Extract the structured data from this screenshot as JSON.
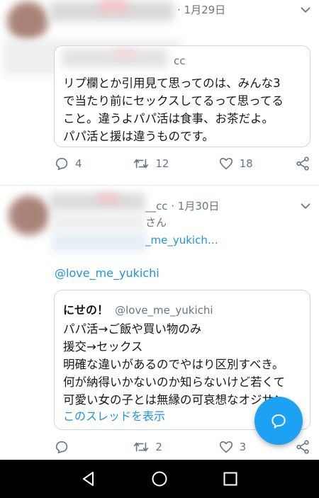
{
  "tweet1": {
    "date": "· 1月29日",
    "quote_handle_fragment": "cc",
    "quote_lines": [
      "リプ欄とか引用見て思ってのは、みんな3",
      "で当たり前にセックスしてるって思ってる",
      "こと。違うよパパ活は食事、お茶だよ。",
      "パパ活と援は違うものです。"
    ],
    "actions": {
      "replies": "4",
      "retweets": "12",
      "likes": "18"
    }
  },
  "tweet2": {
    "author_fragment": "__cc · 1月30日",
    "name_fragment": "さん",
    "reply_to_fragment": "_me_yukich…",
    "mention": "@love_me_yukichi",
    "quote": {
      "name": "にせの！",
      "handle": "@love_me_yukichi",
      "lines": [
        "パパ活→ご飯や買い物のみ",
        "援交→セックス",
        "明確な違いがあるのでやはり区別すべき。",
        "何が納得いかないのか知らないけど若くて",
        "可愛い女の子とは無縁の可哀想なオジサン"
      ],
      "show_thread": "このスレッドを表示"
    },
    "actions": {
      "replies": "",
      "retweets": "2",
      "likes": "3"
    }
  },
  "icons": {
    "reply": "reply-icon",
    "retweet": "retweet-icon",
    "like": "heart-icon",
    "share": "share-icon",
    "compose": "compose-icon",
    "nav_back": "back-icon",
    "nav_home": "home-icon",
    "nav_recents": "recents-icon"
  },
  "colors": {
    "accent": "#1da1f2",
    "link": "#1b95e0",
    "secondary_text": "#657786",
    "border": "#ccd6dd"
  }
}
